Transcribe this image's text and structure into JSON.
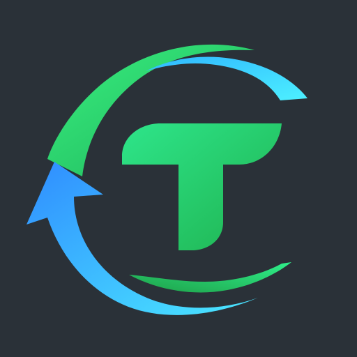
{
  "app": {
    "logo_name": "T refresh logo",
    "logo_letter": "T"
  },
  "colors": {
    "background": "#2a3138",
    "green_light": "#2ee58a",
    "green_dark": "#1fb24f",
    "blue_light": "#48e6ff",
    "blue_dark": "#2f8cff"
  },
  "icons": {
    "upper_arc": "green-arc-icon",
    "lower_arrow": "blue-arrow-icon",
    "inner_swoosh_top": "blue-swoosh-icon",
    "inner_swoosh_bottom": "green-swoosh-icon",
    "letter": "letter-t-icon"
  }
}
